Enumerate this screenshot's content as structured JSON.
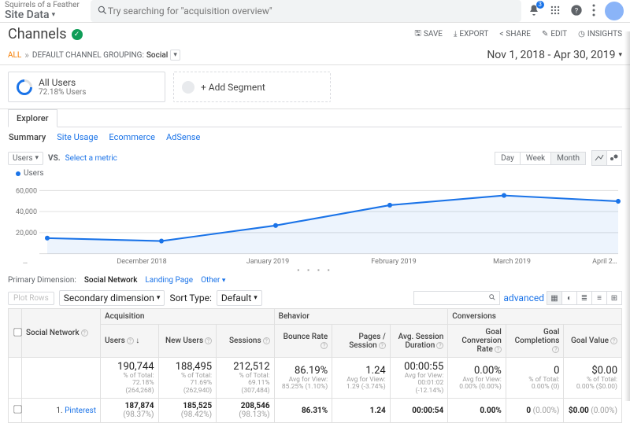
{
  "header": {
    "account_line1": "Squirrels of a Feather",
    "account_line2": "Site Data",
    "search_placeholder": "Try searching for \"acquisition overview\"",
    "notif_count": "3"
  },
  "report": {
    "title": "Channels",
    "actions": {
      "save": "SAVE",
      "export": "EXPORT",
      "share": "SHARE",
      "edit": "EDIT",
      "insights": "INSIGHTS"
    }
  },
  "crumb": {
    "all": "ALL",
    "sep": "»",
    "label": "DEFAULT CHANNEL GROUPING:",
    "value": "Social"
  },
  "daterange": "Nov 1, 2018 - Apr 30, 2019",
  "segments": {
    "seg1_label": "All Users",
    "seg1_sub": "72.18% Users",
    "seg2_label": "+ Add Segment"
  },
  "tabs": {
    "explorer": "Explorer",
    "sub": [
      "Summary",
      "Site Usage",
      "Ecommerce",
      "AdSense"
    ],
    "active_index": 0
  },
  "chart": {
    "metric_sel": "Users",
    "vs_label": "VS.",
    "select_metric": "Select a metric",
    "time_buttons": [
      "Day",
      "Week",
      "Month"
    ],
    "time_active": 2,
    "legend_label": "Users",
    "y_ticks": [
      "60,000",
      "40,000",
      "20,000"
    ],
    "x_ticks": [
      "…",
      "December 2018",
      "January 2019",
      "February 2019",
      "March 2019",
      "April 2…"
    ]
  },
  "chart_data": {
    "type": "line",
    "title": "Users",
    "xlabel": "",
    "ylabel": "",
    "ylim": [
      0,
      70000
    ],
    "x": [
      "Nov 2018",
      "Dec 2018",
      "Jan 2019",
      "Feb 2019",
      "Mar 2019",
      "Apr 2019"
    ],
    "series": [
      {
        "name": "Users",
        "values": [
          16000,
          13000,
          29000,
          50000,
          60000,
          54000
        ]
      }
    ]
  },
  "dim": {
    "label": "Primary Dimension:",
    "active": "Social Network",
    "other_dims": [
      "Landing Page",
      "Other"
    ]
  },
  "tablectl": {
    "plot_rows": "Plot Rows",
    "sec_dim": "Secondary dimension",
    "sort_label": "Sort Type:",
    "sort_value": "Default",
    "advanced": "advanced"
  },
  "table": {
    "dim_col": "Social Network",
    "groups": [
      "Acquisition",
      "Behavior",
      "Conversions"
    ],
    "cols": [
      "Users",
      "New Users",
      "Sessions",
      "Bounce Rate",
      "Pages / Session",
      "Avg. Session Duration",
      "Goal Conversion Rate",
      "Goal Completions",
      "Goal Value"
    ],
    "totals": {
      "values": [
        "190,744",
        "188,495",
        "212,512",
        "86.19%",
        "1.24",
        "00:00:55",
        "0.00%",
        "0",
        "$0.00"
      ],
      "subs": [
        "% of Total: 72.18% (264,268)",
        "% of Total: 71.69% (262,940)",
        "% of Total: 69.11% (307,484)",
        "Avg for View: 85.25% (1.10%)",
        "Avg for View: 1.29 (-3.74%)",
        "Avg for View: 00:01:02 (-12.14%)",
        "Avg for View: 0.00% (0.00%)",
        "% of Total: 0.00% (0)",
        "% of Total: 0.00% ($0.00)"
      ]
    },
    "rows": [
      {
        "index": "1.",
        "name": "Pinterest",
        "cells": [
          {
            "v": "187,874",
            "p": "(98.37%)"
          },
          {
            "v": "185,525",
            "p": "(98.42%)"
          },
          {
            "v": "208,546",
            "p": "(98.13%)"
          },
          {
            "v": "86.31%",
            "p": ""
          },
          {
            "v": "1.24",
            "p": ""
          },
          {
            "v": "00:00:54",
            "p": ""
          },
          {
            "v": "0.00%",
            "p": ""
          },
          {
            "v": "0",
            "p": "(0.00%)"
          },
          {
            "v": "$0.00",
            "p": "(0.00%)"
          }
        ]
      }
    ]
  }
}
